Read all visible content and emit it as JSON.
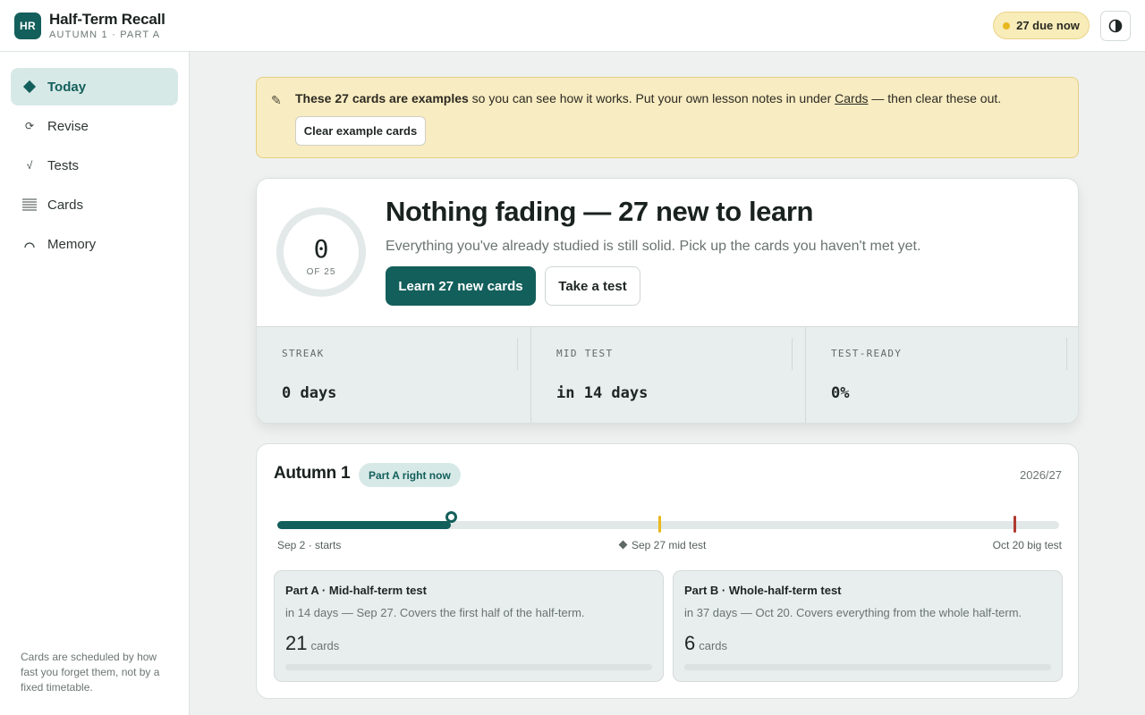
{
  "app": {
    "logo_initials": "HR",
    "title": "Half-Term Recall",
    "subtitle": "AUTUMN 1 · PART A",
    "due_label": "27 due now",
    "due_dot_color": "#e8b81e",
    "brand_color": "#135f5b"
  },
  "sidebar": {
    "items": [
      {
        "label": "Today",
        "icon": "diamond-icon"
      },
      {
        "label": "Revise",
        "icon": "refresh-icon"
      },
      {
        "label": "Tests",
        "icon": "check-icon"
      },
      {
        "label": "Cards",
        "icon": "list-icon"
      },
      {
        "label": "Memory",
        "icon": "arc-icon"
      }
    ],
    "footer_note": "Cards are scheduled by how fast you forget them, not by a fixed timetable."
  },
  "banner": {
    "bold": "These 27 cards are examples",
    "text_before_link": " so you can see how it works. Put your own lesson notes in under ",
    "link": "Cards",
    "text_after_link": " — then clear these out.",
    "button": "Clear example cards"
  },
  "hero": {
    "ring_value": "0",
    "ring_total": "OF 25",
    "title": "Nothing fading — 27 new to learn",
    "subtitle": "Everything you've already studied is still solid. Pick up the cards you haven't met yet.",
    "primary_button": "Learn 27 new cards",
    "secondary_button": "Take a test",
    "stats": [
      {
        "label": "STREAK",
        "value": "0 days"
      },
      {
        "label": "MID TEST",
        "value": "in 14 days"
      },
      {
        "label": "TEST-READY",
        "value": "0%"
      }
    ]
  },
  "term": {
    "title": "Autumn 1",
    "badge": "Part A right now",
    "year": "2026/27",
    "timeline": {
      "progress": 0.222,
      "start_label": "Sep 2 · starts",
      "mid_label": "Sep 27 mid test",
      "mid_position": 0.489,
      "end_label": "Oct 20 big test",
      "end_position": 0.943,
      "mid_color": "#e8b81e",
      "end_color": "#b03a2e"
    },
    "parts": [
      {
        "title": "Part A · Mid-half-term test",
        "desc": "in 14 days — Sep 27. Covers the first half of the half-term.",
        "count": "21",
        "unit": "cards"
      },
      {
        "title": "Part B · Whole-half-term test",
        "desc": "in 37 days — Oct 20. Covers everything from the whole half-term.",
        "count": "6",
        "unit": "cards"
      }
    ]
  }
}
